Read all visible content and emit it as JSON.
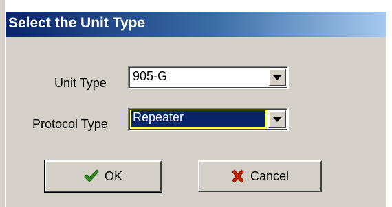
{
  "dialog": {
    "title": "Select the Unit Type"
  },
  "unit_type": {
    "label": "Unit Type",
    "value": "905-G",
    "arrow_icon": "chevron-down-icon"
  },
  "protocol_type": {
    "label": "Protocol Type",
    "value": "Repeater",
    "arrow_icon": "chevron-down-icon"
  },
  "buttons": {
    "ok_label": "OK",
    "ok_icon": "checkmark-icon",
    "cancel_label": "Cancel",
    "cancel_icon": "x-mark-icon"
  },
  "colors": {
    "title_bar": "#0a246a",
    "dialog_face": "#d4d0c8",
    "selection": "#0a246a",
    "ok_icon": "#2e8b1e",
    "cancel_icon": "#cc2200"
  }
}
